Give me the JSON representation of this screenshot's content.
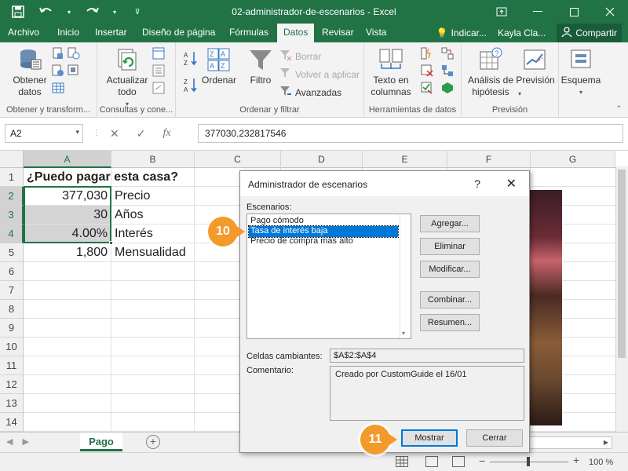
{
  "window": {
    "title": "02-administrador-de-escenarios - Excel",
    "user": "Kayla Cla...",
    "share_label": "Compartir",
    "tell_me": "Indicar..."
  },
  "tabs": [
    "Archivo",
    "Inicio",
    "Insertar",
    "Diseño de página",
    "Fórmulas",
    "Datos",
    "Revisar",
    "Vista"
  ],
  "active_tab": "Datos",
  "ribbon": {
    "get_data": {
      "label_1": "Obtener",
      "label_2": "datos",
      "group": "Obtener y transform..."
    },
    "queries": {
      "refresh_1": "Actualizar",
      "refresh_2": "todo",
      "group": "Consultas y cone..."
    },
    "sort": {
      "sort_label": "Ordenar",
      "filter_label": "Filtro",
      "clear": "Borrar",
      "reapply": "Volver a aplicar",
      "advanced": "Avanzadas",
      "group": "Ordenar y filtrar"
    },
    "data_tools": {
      "text_to_columns_1": "Texto en",
      "text_to_columns_2": "columnas",
      "group": "Herramientas de datos"
    },
    "forecast": {
      "whatif_1": "Análisis de",
      "whatif_2": "hipótesis",
      "forecast_sheet": "Previsión",
      "group": "Previsión"
    },
    "outline": {
      "label": "Esquema"
    }
  },
  "formula_bar": {
    "name_box": "A2",
    "formula": "377030.232817546",
    "fx": "fx"
  },
  "columns": [
    "A",
    "B",
    "C",
    "D",
    "E",
    "F",
    "G"
  ],
  "rows": [
    "1",
    "2",
    "3",
    "4",
    "5",
    "6",
    "7",
    "8",
    "9",
    "10",
    "11",
    "12",
    "13",
    "14"
  ],
  "cells": {
    "a1": "¿Puedo pagar esta casa?",
    "a2": "377,030",
    "b2": "Precio",
    "a3": "30",
    "b3": "Años",
    "a4": "4.00%",
    "b4": "Interés",
    "a5": "1,800",
    "b5": "Mensualidad"
  },
  "sheet": {
    "tab": "Pago",
    "add": "+",
    "zoom": "100 %"
  },
  "dialog": {
    "title": "Administrador de escenarios",
    "help": "?",
    "close": "✕",
    "scenarios_label": "Escenarios:",
    "scenarios": [
      "Pago cómodo",
      "Tasa de interés baja",
      "Precio de compra más alto"
    ],
    "selected_index": 1,
    "buttons": {
      "add": "Agregar...",
      "delete": "Eliminar",
      "edit": "Modificar...",
      "merge": "Combinar...",
      "summary": "Resumen..."
    },
    "changing_cells_label": "Celdas cambiantes:",
    "changing_cells": "$A$2:$A$4",
    "comment_label": "Comentario:",
    "comment": "Creado por CustomGuide el 16/01",
    "show": "Mostrar",
    "close_btn": "Cerrar"
  },
  "markers": {
    "step_10": "10",
    "step_11": "11"
  },
  "colors": {
    "excel_green": "#217346",
    "marker_orange": "#f39a2b",
    "selection_blue": "#0078d7"
  }
}
